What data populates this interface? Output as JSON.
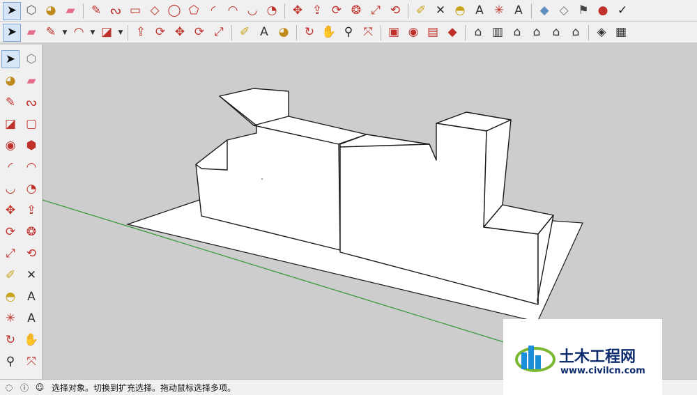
{
  "toolbar_top": [
    {
      "icon": "select-arrow-icon",
      "glyph": "➤",
      "color": "#111111",
      "active": true
    },
    {
      "icon": "make-component-icon",
      "glyph": "⬡",
      "color": "#555555"
    },
    {
      "icon": "paint-bucket-icon",
      "glyph": "◕",
      "color": "#c08a1a"
    },
    {
      "icon": "eraser-icon",
      "glyph": "▰",
      "color": "#e46b8a"
    },
    {
      "sep": true
    },
    {
      "icon": "pencil-line-icon",
      "glyph": "✎",
      "color": "#c0312b"
    },
    {
      "icon": "freehand-icon",
      "glyph": "ᔓ",
      "color": "#c0312b"
    },
    {
      "icon": "rectangle-icon",
      "glyph": "▭",
      "color": "#c0312b"
    },
    {
      "icon": "rotated-rectangle-icon",
      "glyph": "◇",
      "color": "#c0312b"
    },
    {
      "icon": "circle-icon",
      "glyph": "◯",
      "color": "#c0312b"
    },
    {
      "icon": "polygon-icon",
      "glyph": "⬠",
      "color": "#c0312b"
    },
    {
      "icon": "arc-icon",
      "glyph": "◜",
      "color": "#c0312b"
    },
    {
      "icon": "two-point-arc-icon",
      "glyph": "◠",
      "color": "#c0312b"
    },
    {
      "icon": "three-point-arc-icon",
      "glyph": "◡",
      "color": "#c0312b"
    },
    {
      "icon": "pie-icon",
      "glyph": "◔",
      "color": "#c0312b"
    },
    {
      "sep": true
    },
    {
      "icon": "move-icon",
      "glyph": "✥",
      "color": "#c0312b"
    },
    {
      "icon": "push-pull-icon",
      "glyph": "⇪",
      "color": "#c0312b"
    },
    {
      "icon": "rotate-icon",
      "glyph": "⟳",
      "color": "#c0312b"
    },
    {
      "icon": "follow-me-icon",
      "glyph": "❂",
      "color": "#c0312b"
    },
    {
      "icon": "scale-icon",
      "glyph": "⤢",
      "color": "#c0312b"
    },
    {
      "icon": "offset-icon",
      "glyph": "⟲",
      "color": "#c0312b"
    },
    {
      "sep": true
    },
    {
      "icon": "tape-measure-icon",
      "glyph": "✐",
      "color": "#c7a21a"
    },
    {
      "icon": "dimension-icon",
      "glyph": "✕",
      "color": "#333333"
    },
    {
      "icon": "protractor-icon",
      "glyph": "◓",
      "color": "#c7a21a"
    },
    {
      "icon": "text-label-icon",
      "glyph": "A",
      "color": "#333333"
    },
    {
      "icon": "axes-icon",
      "glyph": "✳",
      "color": "#c0312b"
    },
    {
      "icon": "3d-text-icon",
      "glyph": "A",
      "color": "#333333"
    },
    {
      "sep": true
    },
    {
      "icon": "section-plane-icon",
      "glyph": "◆",
      "color": "#5f8fc0"
    },
    {
      "icon": "paper-icon",
      "glyph": "◇",
      "color": "#777777"
    },
    {
      "icon": "flag-icon",
      "glyph": "⚑",
      "color": "#444444"
    },
    {
      "icon": "warehouse-icon",
      "glyph": "●",
      "color": "#c0312b"
    },
    {
      "icon": "check-icon",
      "glyph": "✓",
      "color": "#222222"
    }
  ],
  "toolbar_second": [
    {
      "icon": "select-arrow-icon",
      "glyph": "➤",
      "color": "#111111",
      "active": true
    },
    {
      "icon": "eraser-icon",
      "glyph": "▰",
      "color": "#e46b8a"
    },
    {
      "icon": "pencil-line-icon",
      "glyph": "✎",
      "color": "#c0312b",
      "dropdown": true
    },
    {
      "icon": "arc-icon",
      "glyph": "◠",
      "color": "#c0312b",
      "dropdown": true
    },
    {
      "icon": "rectangle-icon",
      "glyph": "◪",
      "color": "#c0312b",
      "dropdown": true
    },
    {
      "sep": true
    },
    {
      "icon": "push-pull-icon",
      "glyph": "⇪",
      "color": "#c0312b"
    },
    {
      "icon": "follow-me-icon",
      "glyph": "⟳",
      "color": "#c0312b"
    },
    {
      "icon": "move-icon",
      "glyph": "✥",
      "color": "#c0312b"
    },
    {
      "icon": "rotate-icon",
      "glyph": "⟳",
      "color": "#c0312b"
    },
    {
      "icon": "scale-icon",
      "glyph": "⤢",
      "color": "#c0312b"
    },
    {
      "sep": true
    },
    {
      "icon": "tape-measure-icon",
      "glyph": "✐",
      "color": "#c7a21a"
    },
    {
      "icon": "text-label-icon",
      "glyph": "A",
      "color": "#333333"
    },
    {
      "icon": "paint-bucket-icon",
      "glyph": "◕",
      "color": "#c08a1a"
    },
    {
      "sep": true
    },
    {
      "icon": "orbit-icon",
      "glyph": "↻",
      "color": "#c0312b"
    },
    {
      "icon": "pan-hand-icon",
      "glyph": "✋",
      "color": "#c7a21a"
    },
    {
      "icon": "zoom-icon",
      "glyph": "⚲",
      "color": "#222222"
    },
    {
      "icon": "zoom-extents-icon",
      "glyph": "⤧",
      "color": "#c0312b"
    },
    {
      "sep": true
    },
    {
      "icon": "warehouse-icon",
      "glyph": "▣",
      "color": "#c0312b"
    },
    {
      "icon": "extension-warehouse-icon",
      "glyph": "◉",
      "color": "#c0312b"
    },
    {
      "icon": "layout-icon",
      "glyph": "▤",
      "color": "#c0312b"
    },
    {
      "icon": "extension-manager-icon",
      "glyph": "◆",
      "color": "#c0312b"
    },
    {
      "sep": true
    },
    {
      "icon": "iso-view-icon",
      "glyph": "⌂",
      "color": "#333333"
    },
    {
      "icon": "top-view-icon",
      "glyph": "▥",
      "color": "#333333"
    },
    {
      "icon": "front-view-icon",
      "glyph": "⌂",
      "color": "#333333"
    },
    {
      "icon": "right-view-icon",
      "glyph": "⌂",
      "color": "#333333"
    },
    {
      "icon": "back-view-icon",
      "glyph": "⌂",
      "color": "#333333"
    },
    {
      "icon": "left-view-icon",
      "glyph": "⌂",
      "color": "#333333"
    },
    {
      "sep": true
    },
    {
      "icon": "xray-icon",
      "glyph": "◈",
      "color": "#333333"
    },
    {
      "icon": "wireframe-icon",
      "glyph": "▦",
      "color": "#333333"
    }
  ],
  "left_tools": [
    {
      "icon": "select-arrow-icon",
      "glyph": "➤",
      "color": "#111111",
      "active": true
    },
    {
      "icon": "make-component-icon",
      "glyph": "⬡",
      "color": "#777777"
    },
    {
      "icon": "paint-bucket-icon",
      "glyph": "◕",
      "color": "#c08a1a"
    },
    {
      "icon": "eraser-icon",
      "glyph": "▰",
      "color": "#e46b8a"
    },
    {
      "icon": "pencil-line-icon",
      "glyph": "✎",
      "color": "#c0312b"
    },
    {
      "icon": "freehand-icon",
      "glyph": "ᔓ",
      "color": "#c0312b"
    },
    {
      "icon": "rectangle-icon",
      "glyph": "◪",
      "color": "#c0312b"
    },
    {
      "icon": "rotated-rectangle-icon",
      "glyph": "▢",
      "color": "#c0312b"
    },
    {
      "icon": "circle-icon",
      "glyph": "◉",
      "color": "#c0312b"
    },
    {
      "icon": "polygon-icon",
      "glyph": "⬢",
      "color": "#c0312b"
    },
    {
      "icon": "arc-icon",
      "glyph": "◜",
      "color": "#c0312b"
    },
    {
      "icon": "two-point-arc-icon",
      "glyph": "◠",
      "color": "#c0312b"
    },
    {
      "icon": "three-point-arc-icon",
      "glyph": "◡",
      "color": "#c0312b"
    },
    {
      "icon": "pie-icon",
      "glyph": "◔",
      "color": "#c0312b"
    },
    {
      "icon": "move-icon",
      "glyph": "✥",
      "color": "#c0312b"
    },
    {
      "icon": "push-pull-icon",
      "glyph": "⇪",
      "color": "#c0312b"
    },
    {
      "icon": "rotate-icon",
      "glyph": "⟳",
      "color": "#c0312b"
    },
    {
      "icon": "follow-me-icon",
      "glyph": "❂",
      "color": "#c0312b"
    },
    {
      "icon": "scale-icon",
      "glyph": "⤢",
      "color": "#c0312b"
    },
    {
      "icon": "offset-icon",
      "glyph": "⟲",
      "color": "#c0312b"
    },
    {
      "icon": "tape-measure-icon",
      "glyph": "✐",
      "color": "#c7a21a"
    },
    {
      "icon": "dimension-icon",
      "glyph": "✕",
      "color": "#333333"
    },
    {
      "icon": "protractor-icon",
      "glyph": "◓",
      "color": "#c7a21a"
    },
    {
      "icon": "text-label-icon",
      "glyph": "A",
      "color": "#333333"
    },
    {
      "icon": "axes-icon",
      "glyph": "✳",
      "color": "#c0312b"
    },
    {
      "icon": "3d-text-icon",
      "glyph": "A",
      "color": "#333333"
    },
    {
      "icon": "orbit-icon",
      "glyph": "↻",
      "color": "#c0312b"
    },
    {
      "icon": "pan-hand-icon",
      "glyph": "✋",
      "color": "#c7a21a"
    },
    {
      "icon": "zoom-icon",
      "glyph": "⚲",
      "color": "#222222"
    },
    {
      "icon": "zoom-extents-icon",
      "glyph": "⤧",
      "color": "#c0312b"
    }
  ],
  "status_bar": {
    "text": "选择对象。切换到扩充选择。拖动鼠标选择多项。",
    "icons": [
      "geo-location-icon",
      "info-icon",
      "user-icon"
    ]
  },
  "watermark": {
    "name": "土木工程网",
    "url": "www.civilcn.com"
  },
  "colors": {
    "viewport_bg": "#cdcdcd",
    "ground": "#ffffff",
    "axis_green": "#3a9a3a",
    "edge": "#1a1a1a",
    "watermark_text": "#0d2c6e",
    "watermark_blue": "#1a8ed8",
    "watermark_green": "#7ab833"
  }
}
